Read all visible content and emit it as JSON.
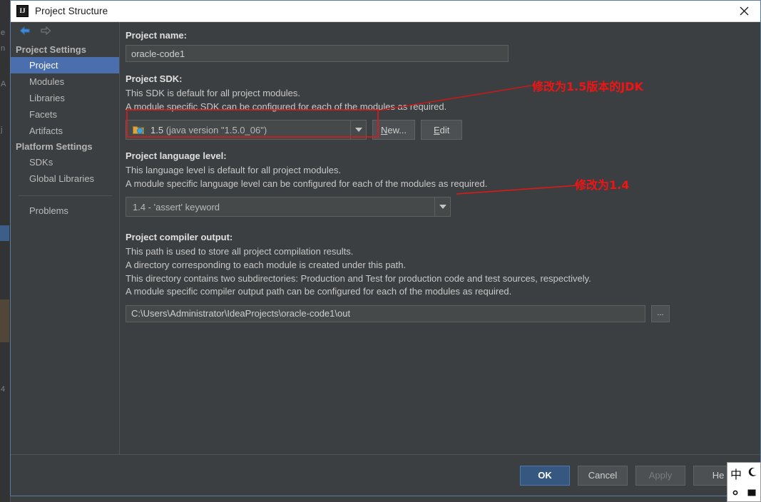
{
  "window": {
    "title": "Project Structure",
    "logo_icon": "intellij-idea-logo-icon",
    "close_icon": "close-icon"
  },
  "nav": {
    "back_icon": "arrow-back-icon",
    "forward_icon": "arrow-forward-icon"
  },
  "sidebar": {
    "groups": [
      {
        "label": "Project Settings",
        "items": [
          {
            "label": "Project",
            "selected": true
          },
          {
            "label": "Modules",
            "selected": false
          },
          {
            "label": "Libraries",
            "selected": false
          },
          {
            "label": "Facets",
            "selected": false
          },
          {
            "label": "Artifacts",
            "selected": false
          }
        ]
      },
      {
        "label": "Platform Settings",
        "items": [
          {
            "label": "SDKs",
            "selected": false
          },
          {
            "label": "Global Libraries",
            "selected": false
          }
        ]
      }
    ],
    "problems_label": "Problems"
  },
  "main": {
    "project_name": {
      "label": "Project name:",
      "value": "oracle-code1",
      "placeholder": ""
    },
    "project_sdk": {
      "label": "Project SDK:",
      "desc_line1": "This SDK is default for all project modules.",
      "desc_line2": "A module specific SDK can be configured for each of the modules as required.",
      "selected_version": "1.5",
      "selected_detail": "(java version \"1.5.0_06\")",
      "icon": "jdk-folder-icon",
      "dropdown_icon": "chevron-down-icon",
      "new_button": "New...",
      "new_button_mnemonic": "N",
      "edit_button": "Edit",
      "edit_button_mnemonic": "E"
    },
    "language_level": {
      "label": "Project language level:",
      "desc_line1": "This language level is default for all project modules.",
      "desc_line2": "A module specific language level can be configured for each of the modules as required.",
      "selected": "1.4 - 'assert' keyword",
      "dropdown_icon": "chevron-down-icon"
    },
    "compiler_output": {
      "label": "Project compiler output:",
      "desc_line1": "This path is used to store all project compilation results.",
      "desc_line2": "A directory corresponding to each module is created under this path.",
      "desc_line3": "This directory contains two subdirectories: Production and Test for production code and test sources, respectively.",
      "desc_line4": "A module specific compiler output path can be configured for each of the modules as required.",
      "value": "C:\\Users\\Administrator\\IdeaProjects\\oracle-code1\\out",
      "browse_button": "...",
      "browse_icon": "ellipsis-browse-icon"
    }
  },
  "annotations": {
    "color": "#f01414",
    "items": [
      {
        "text": "修改为1.5版本的JDK",
        "target": "project-sdk-combo"
      },
      {
        "text": "修改为1.4",
        "target": "language-level-combo"
      }
    ]
  },
  "footer": {
    "ok": "OK",
    "cancel": "Cancel",
    "apply": "Apply",
    "help": "He"
  },
  "ime": {
    "mode_label": "中",
    "moon_icon": "moon-icon",
    "dot_icon": "dot-icon",
    "keyboard_icon": "keyboard-icon"
  },
  "background": {
    "glyphs": [
      "e",
      "n",
      "A",
      "j",
      "4"
    ]
  },
  "colors": {
    "accent_blue": "#4b6eaf",
    "primary_button": "#365880",
    "annotation_red": "#f01414",
    "dialog_bg": "#3c3f41",
    "field_bg": "#45494a"
  }
}
